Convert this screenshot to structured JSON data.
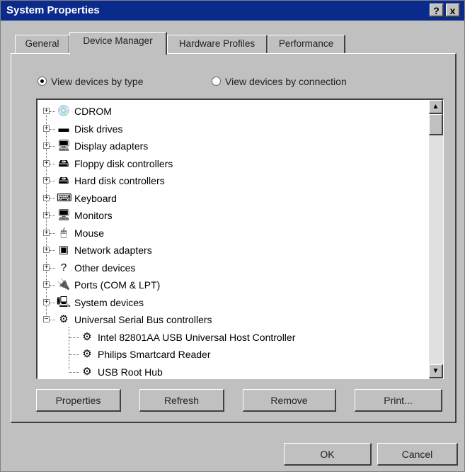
{
  "window": {
    "title": "System Properties",
    "help_label": "?",
    "close_label": "x"
  },
  "tabs": [
    {
      "label": "General"
    },
    {
      "label": "Device Manager"
    },
    {
      "label": "Hardware Profiles"
    },
    {
      "label": "Performance"
    }
  ],
  "view_options": {
    "by_type": "View devices by type",
    "by_connection": "View devices by connection",
    "selected": "by_type"
  },
  "devices": [
    {
      "label": "CDROM",
      "icon": "cdrom-icon",
      "glyph": "💿"
    },
    {
      "label": "Disk drives",
      "icon": "disk-drive-icon",
      "glyph": "▬"
    },
    {
      "label": "Display adapters",
      "icon": "display-adapter-icon",
      "glyph": "🖥"
    },
    {
      "label": "Floppy disk controllers",
      "icon": "floppy-controller-icon",
      "glyph": "🖴"
    },
    {
      "label": "Hard disk controllers",
      "icon": "hard-disk-controller-icon",
      "glyph": "🖴"
    },
    {
      "label": "Keyboard",
      "icon": "keyboard-icon",
      "glyph": "⌨"
    },
    {
      "label": "Monitors",
      "icon": "monitor-icon",
      "glyph": "🖥"
    },
    {
      "label": "Mouse",
      "icon": "mouse-icon",
      "glyph": "🖱"
    },
    {
      "label": "Network adapters",
      "icon": "network-adapter-icon",
      "glyph": "▣"
    },
    {
      "label": "Other devices",
      "icon": "question-mark-icon",
      "glyph": "?"
    },
    {
      "label": "Ports (COM & LPT)",
      "icon": "port-icon",
      "glyph": "🔌"
    },
    {
      "label": "System devices",
      "icon": "system-device-icon",
      "glyph": "🖳"
    },
    {
      "label": "Universal Serial Bus controllers",
      "icon": "usb-icon",
      "glyph": "⚙"
    }
  ],
  "usb_children": [
    {
      "label": "Intel 82801AA USB Universal Host Controller",
      "icon": "usb-icon"
    },
    {
      "label": "Philips Smartcard Reader",
      "icon": "usb-icon"
    },
    {
      "label": "USB Root Hub",
      "icon": "usb-icon"
    }
  ],
  "actions": {
    "properties": "Properties",
    "refresh": "Refresh",
    "remove": "Remove",
    "print": "Print..."
  },
  "dialog": {
    "ok": "OK",
    "cancel": "Cancel"
  }
}
